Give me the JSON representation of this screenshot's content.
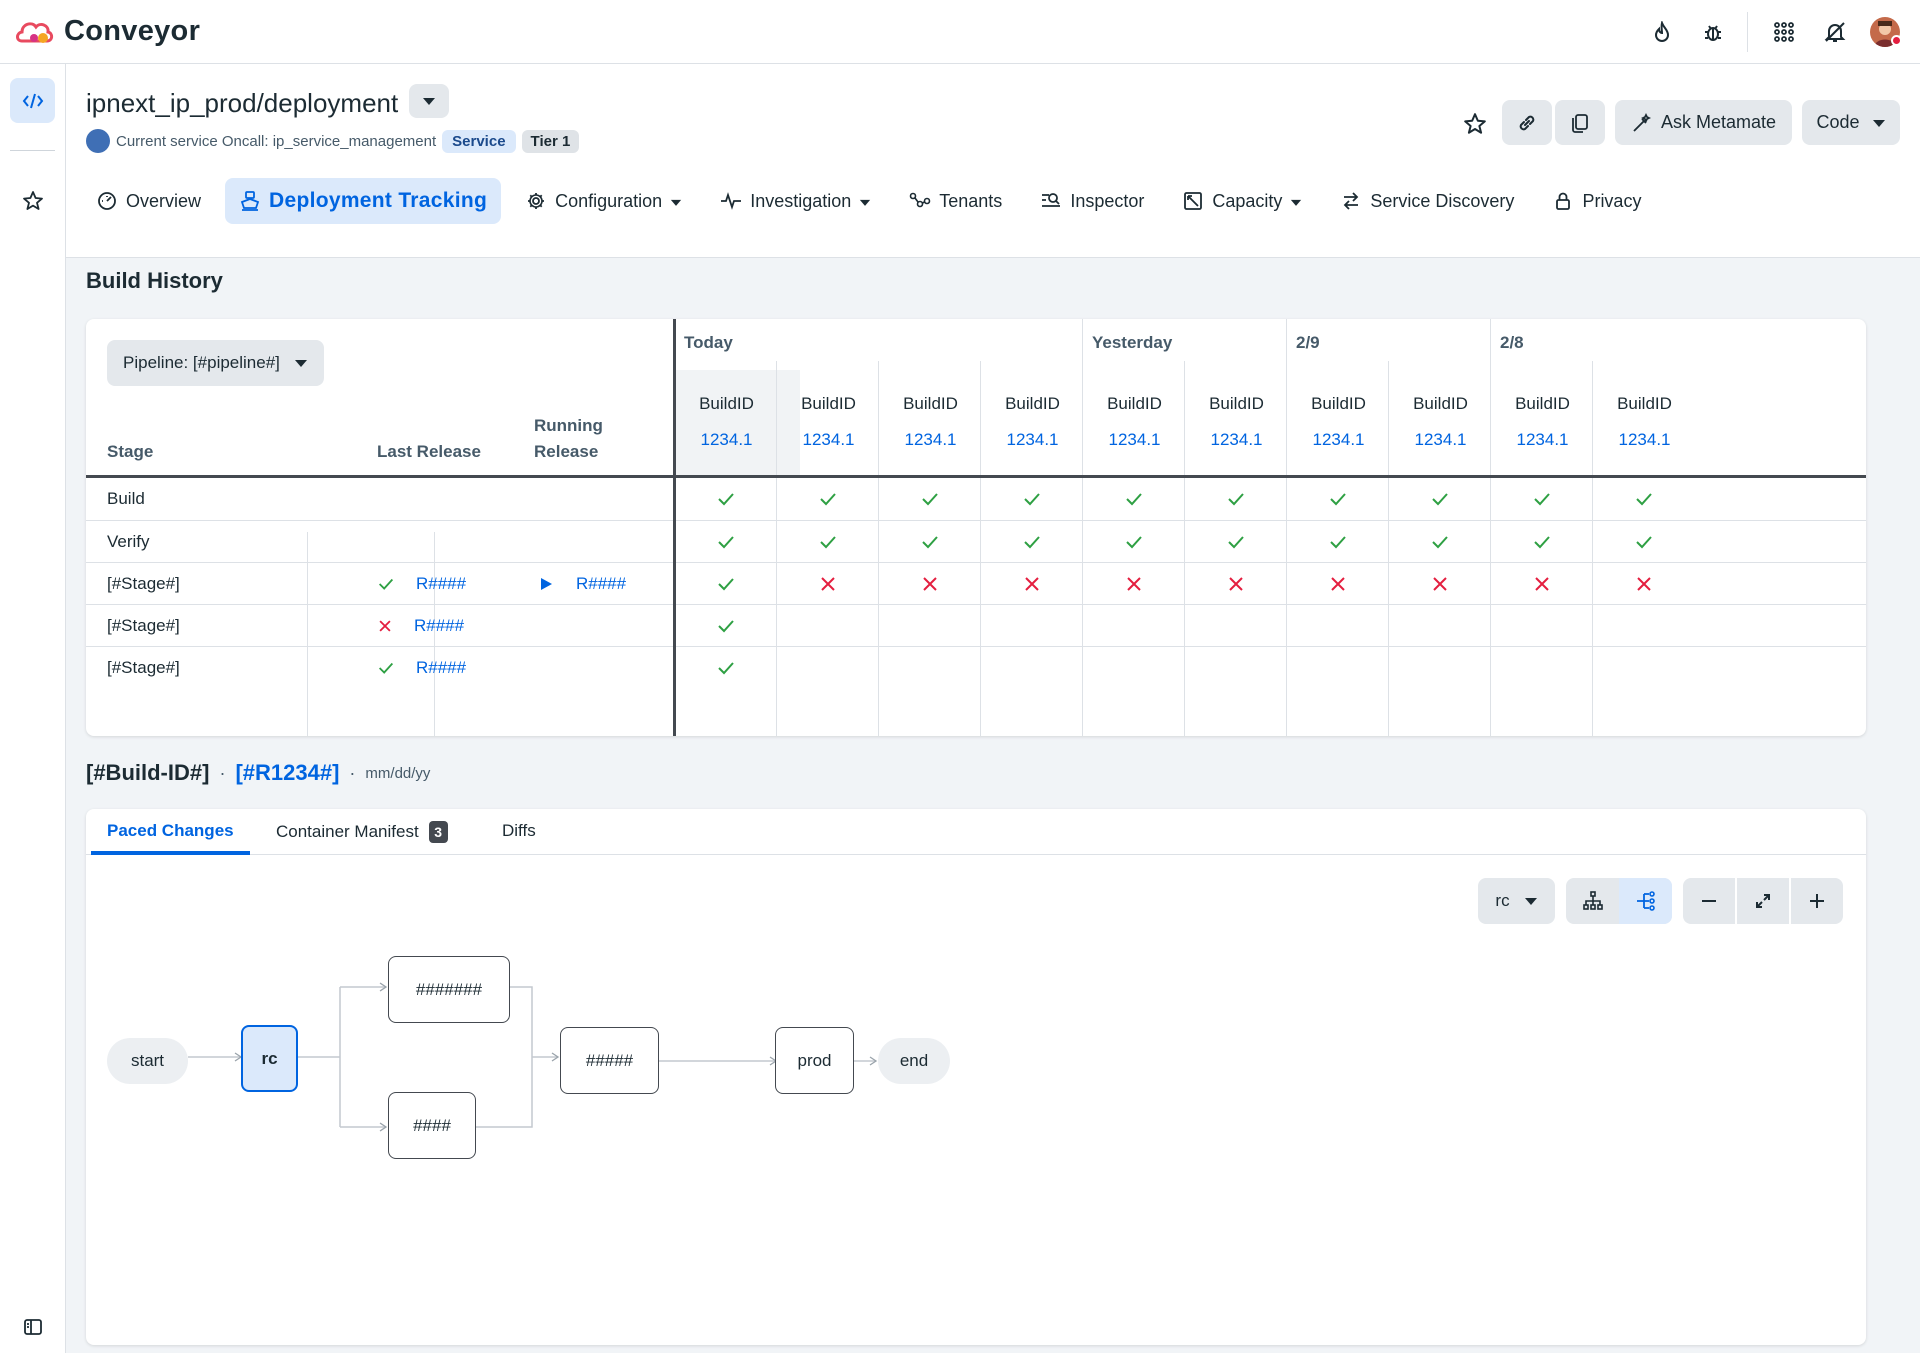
{
  "app": {
    "brand": "Conveyor",
    "top_icons": [
      "flame-icon",
      "bug-icon",
      "apps-grid-icon",
      "notifications-off-icon"
    ]
  },
  "header": {
    "title": "ipnext_ip_prod/deployment",
    "oncall_text": "Current service Oncall: ip_service_management",
    "badge_service": "Service",
    "badge_tier": "Tier 1",
    "ask_label": "Ask Metamate",
    "code_label": "Code"
  },
  "nav": [
    {
      "label": "Overview",
      "icon": "dashboard-icon",
      "caret": false,
      "active": false
    },
    {
      "label": "Deployment Tracking",
      "icon": "ship-icon",
      "caret": false,
      "active": true
    },
    {
      "label": "Configuration",
      "icon": "gear-icon",
      "caret": true,
      "active": false
    },
    {
      "label": "Investigation",
      "icon": "pulse-icon",
      "caret": true,
      "active": false
    },
    {
      "label": "Tenants",
      "icon": "share-nodes-icon",
      "caret": false,
      "active": false
    },
    {
      "label": "Inspector",
      "icon": "search-list-icon",
      "caret": false,
      "active": false
    },
    {
      "label": "Capacity",
      "icon": "resize-icon",
      "caret": true,
      "active": false
    },
    {
      "label": "Service Discovery",
      "icon": "arrows-exchange-icon",
      "caret": false,
      "active": false
    },
    {
      "label": "Privacy",
      "icon": "lock-icon",
      "caret": false,
      "active": false
    }
  ],
  "build_history": {
    "title": "Build History",
    "pipeline_label": "Pipeline: [#pipeline#]",
    "col_stage": "Stage",
    "col_last": "Last Release",
    "col_running": "Running Release",
    "col_running_line1": "Running",
    "col_running_line2": "Release",
    "dates": [
      "Today",
      "Yesterday",
      "2/9",
      "2/8"
    ],
    "build_label": "BuildID",
    "build_value": "1234.1",
    "rows": [
      {
        "stage": "Build",
        "last": null,
        "last_status": null,
        "running": null,
        "results": [
          "ok",
          "ok",
          "ok",
          "ok",
          "ok",
          "ok",
          "ok",
          "ok",
          "ok",
          "ok"
        ]
      },
      {
        "stage": "Verify",
        "last": null,
        "last_status": null,
        "running": null,
        "results": [
          "ok",
          "ok",
          "ok",
          "ok",
          "ok",
          "ok",
          "ok",
          "ok",
          "ok",
          "ok"
        ]
      },
      {
        "stage": "[#Stage#]",
        "last": "R####",
        "last_status": "ok",
        "running": "R####",
        "results": [
          "ok",
          "fail",
          "fail",
          "fail",
          "fail",
          "fail",
          "fail",
          "fail",
          "fail",
          "fail"
        ]
      },
      {
        "stage": "[#Stage#]",
        "last": "R####",
        "last_status": "fail",
        "running": null,
        "results": [
          "ok",
          "",
          "",
          "",
          "",
          "",
          "",
          "",
          "",
          ""
        ]
      },
      {
        "stage": "[#Stage#]",
        "last": "R####",
        "last_status": "ok",
        "running": null,
        "results": [
          "ok",
          "",
          "",
          "",
          "",
          "",
          "",
          "",
          "",
          ""
        ]
      }
    ]
  },
  "build_detail": {
    "build_id": "[#Build-ID#]",
    "sep": "·",
    "release": "[#R1234#]",
    "date": "mm/dd/yy",
    "tabs": [
      {
        "label": "Paced Changes",
        "active": true
      },
      {
        "label": "Container Manifest",
        "count": "3"
      },
      {
        "label": "Diffs"
      }
    ],
    "filter_value": "rc",
    "graph_nodes": {
      "start": "start",
      "rc": "rc",
      "top": "#######",
      "bottom": "####",
      "mid": "#####",
      "prod": "prod",
      "end": "end"
    }
  },
  "colors": {
    "accent": "#0064e0",
    "success": "#2ea043",
    "danger": "#e41e3f"
  }
}
